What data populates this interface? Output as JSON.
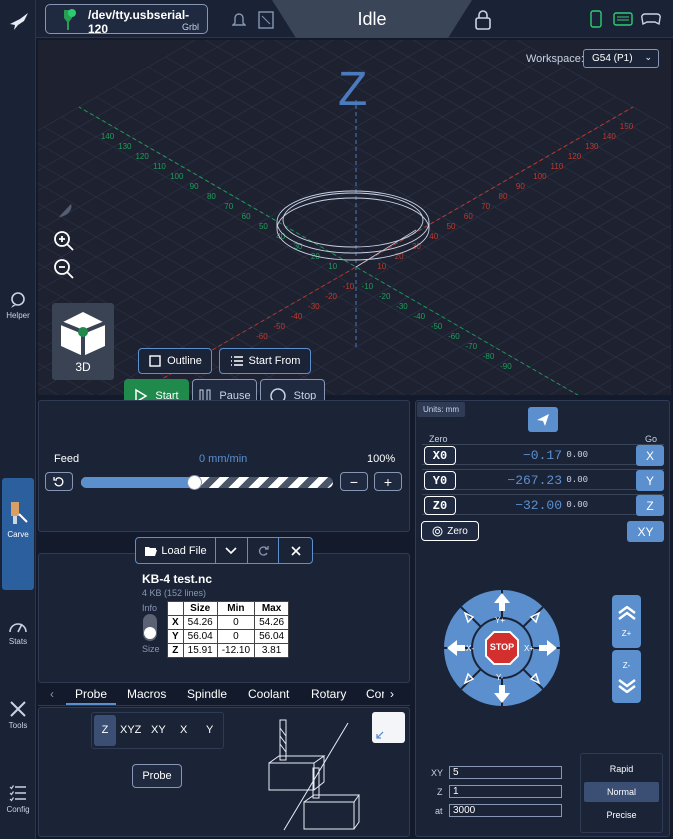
{
  "connection": {
    "port": "/dev/tty.usbserial-120",
    "firmware": "Grbl"
  },
  "status": {
    "state": "Idle"
  },
  "sidebar": {
    "items": [
      {
        "label": "Helper"
      },
      {
        "label": "Carve"
      },
      {
        "label": "Stats"
      },
      {
        "label": "Tools"
      },
      {
        "label": "Config"
      }
    ]
  },
  "visualizer": {
    "workspace_label": "Workspace:",
    "workspace_value": "G54 (P1)",
    "view_label": "3D",
    "axis_letter": "Z",
    "red_ticks": [
      "-60",
      "-50",
      "-40",
      "-30",
      "-20",
      "-10",
      "10",
      "20",
      "30",
      "40",
      "50",
      "60",
      "70",
      "80",
      "90",
      "100",
      "110",
      "120",
      "130",
      "140",
      "150"
    ],
    "green_ticks": [
      "140",
      "130",
      "120",
      "110",
      "100",
      "90",
      "80",
      "70",
      "60",
      "50",
      "40",
      "30",
      "20",
      "10",
      "-10",
      "-20",
      "-30",
      "-40",
      "-50",
      "-60",
      "-70",
      "-80",
      "-90"
    ]
  },
  "toolbar": {
    "outline": "Outline",
    "start_from": "Start From",
    "start": "Start",
    "pause": "Pause",
    "stop": "Stop"
  },
  "feed": {
    "label": "Feed",
    "value": "0 mm/min",
    "percent": "100%",
    "slider_fraction": 0.45,
    "minus": "−",
    "plus": "+"
  },
  "file": {
    "load": "Load File",
    "name": "KB-4 test.nc",
    "size": "4 KB (152 lines)",
    "info_label": "Info",
    "size_label": "Size",
    "headers": [
      "",
      "Size",
      "Min",
      "Max"
    ],
    "rows": [
      [
        "X",
        "54.26",
        "0",
        "54.26"
      ],
      [
        "Y",
        "56.04",
        "0",
        "56.04"
      ],
      [
        "Z",
        "15.91",
        "-12.10",
        "3.81"
      ]
    ]
  },
  "tabs": [
    "Probe",
    "Macros",
    "Spindle",
    "Coolant",
    "Rotary",
    "Cor"
  ],
  "probe": {
    "axes": [
      "Z",
      "XYZ",
      "XY",
      "X",
      "Y"
    ],
    "button": "Probe"
  },
  "dro": {
    "units": "Units: mm",
    "zero_header": "Zero",
    "go_header": "Go",
    "axes": [
      {
        "label": "X0",
        "value": "−0.17",
        "mpos": "0.00",
        "go": "X"
      },
      {
        "label": "Y0",
        "value": "−267.23",
        "mpos": "0.00",
        "go": "Y"
      },
      {
        "label": "Z0",
        "value": "−32.00",
        "mpos": "0.00",
        "go": "Z"
      }
    ],
    "zero_all": "Zero",
    "go_xy": "XY"
  },
  "jog": {
    "stop": "STOP",
    "yplus": "Y+",
    "yminus": "Y-",
    "xplus": "X+",
    "xminus": "X-",
    "zplus": "Z+",
    "zminus": "Z-",
    "xy_label": "XY",
    "xy": "5",
    "z_label": "Z",
    "z": "1",
    "at_label": "at",
    "at": "3000",
    "speeds": [
      "Rapid",
      "Normal",
      "Precise"
    ]
  },
  "colors": {
    "bg": "#121a2b",
    "panel": "#1b2437",
    "accent": "#5b8fce",
    "start": "#1f8a4c",
    "stop": "#d32f2f",
    "x_axis": "#c0392b",
    "y_axis": "#1e9e5a"
  }
}
